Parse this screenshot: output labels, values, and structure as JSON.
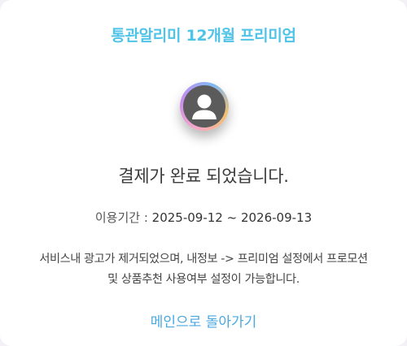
{
  "header": {
    "title": "통관알리미 12개월 프리미엄"
  },
  "avatar": {
    "icon": "user-silhouette-icon"
  },
  "message": {
    "headline": "결제가 완료 되었습니다."
  },
  "period": {
    "label": "이용기간 : ",
    "value": "2025-09-12 ~ 2026-09-13"
  },
  "description": {
    "line1": "서비스내 광고가 제거되었으며, 내정보 -> 프리미엄 설정에서 프로모션",
    "line2": "및 상품추천 사용여부 설정이 가능합니다."
  },
  "actions": {
    "back_label": "메인으로 돌아가기"
  },
  "colors": {
    "accent": "#4fc3e8",
    "link": "#4aa8e0"
  }
}
